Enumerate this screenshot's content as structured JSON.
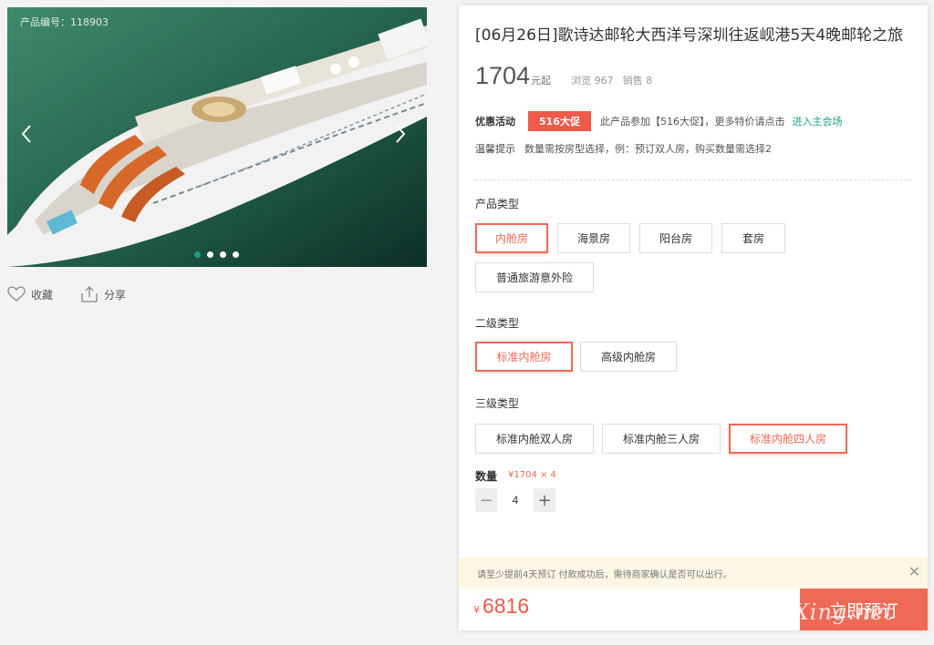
{
  "gallery": {
    "product_code": "产品编号：118903",
    "prev_glyph": "‹",
    "next_glyph": "›",
    "slide_count": 4,
    "active_slide": 1
  },
  "actions": {
    "favorite": "收藏",
    "share": "分享"
  },
  "product": {
    "title": "[06月26日]歌诗达邮轮大西洋号深圳往返岘港5天4晚邮轮之旅",
    "price": "1704",
    "price_unit": "元起",
    "views": "浏览 967",
    "sales": "销售 8"
  },
  "promo": {
    "label": "优惠活动",
    "badge": "516大促",
    "text": "此产品参加【516大促】，更多特价请点击",
    "link": "进入主会场"
  },
  "tip": {
    "label": "温馨提示",
    "text": "数量需按房型选择，例：预订双人房，购买数量需选择2"
  },
  "options": {
    "type_label": "产品类型",
    "types": [
      "内舱房",
      "海景房",
      "阳台房",
      "套房",
      "普通旅游意外险"
    ],
    "sub_label": "二级类型",
    "subs": [
      "标准内舱房",
      "高级内舱房"
    ],
    "third_label": "三级类型",
    "thirds": [
      "标准内舱双人房",
      "标准内舱三人房",
      "标准内舱四人房"
    ]
  },
  "quantity": {
    "label": "数量",
    "calc": "¥1704 × 4",
    "minus": "−",
    "plus": "+",
    "value": "4"
  },
  "footer": {
    "notice": "请至少提前4天预订 付款成功后，需待商家确认是否可以出行。",
    "close": "✕",
    "total_yen": "¥",
    "total": "6816",
    "book": "立即预订"
  },
  "watermark": "eLvXing.net",
  "colors": {
    "accent": "#ef5a4b",
    "link": "#1aa08a",
    "notice_bg": "#fcf6e4"
  }
}
